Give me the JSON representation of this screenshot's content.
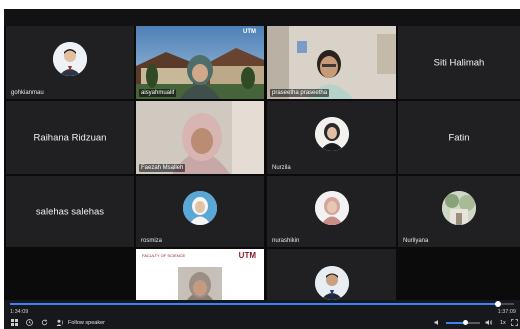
{
  "participants": {
    "gohkianmau": "gohkianmau",
    "aisyahmualif": "aisyahmualif",
    "praseetha": "praseetha praseetha",
    "siti_halimah": "Siti Halimah",
    "raihana": "Raihana Ridzuan",
    "faezah": "Faezah Msalleh",
    "nurzila": "Nurzila",
    "fatin": "Fatin",
    "salehas": "salehas salehas",
    "rosmiza": "rosmiza",
    "nurashikin": "nurashikin",
    "nurliyana": "Nurliyana"
  },
  "watermark": "UTM",
  "slide": {
    "header": "FACULTY OF SCIENCE",
    "logo": "UTM"
  },
  "player": {
    "current_time": "1:34:09",
    "total_time": "1:37:09",
    "progress_fraction": 0.969,
    "volume_fraction": 0.55,
    "follow_speaker_label": "Follow speaker",
    "speed_label": "1x"
  },
  "colors": {
    "accent": "#3b82f6",
    "tile_bg": "#202022",
    "stage_bg": "#0b0b0c"
  },
  "icons": {
    "grid": "grid-icon",
    "clock": "clock-icon",
    "refresh": "refresh-icon",
    "follow": "follow-speaker-icon",
    "volume_low": "volume-low-icon",
    "volume_high": "volume-high-icon",
    "fullscreen": "fullscreen-icon"
  }
}
